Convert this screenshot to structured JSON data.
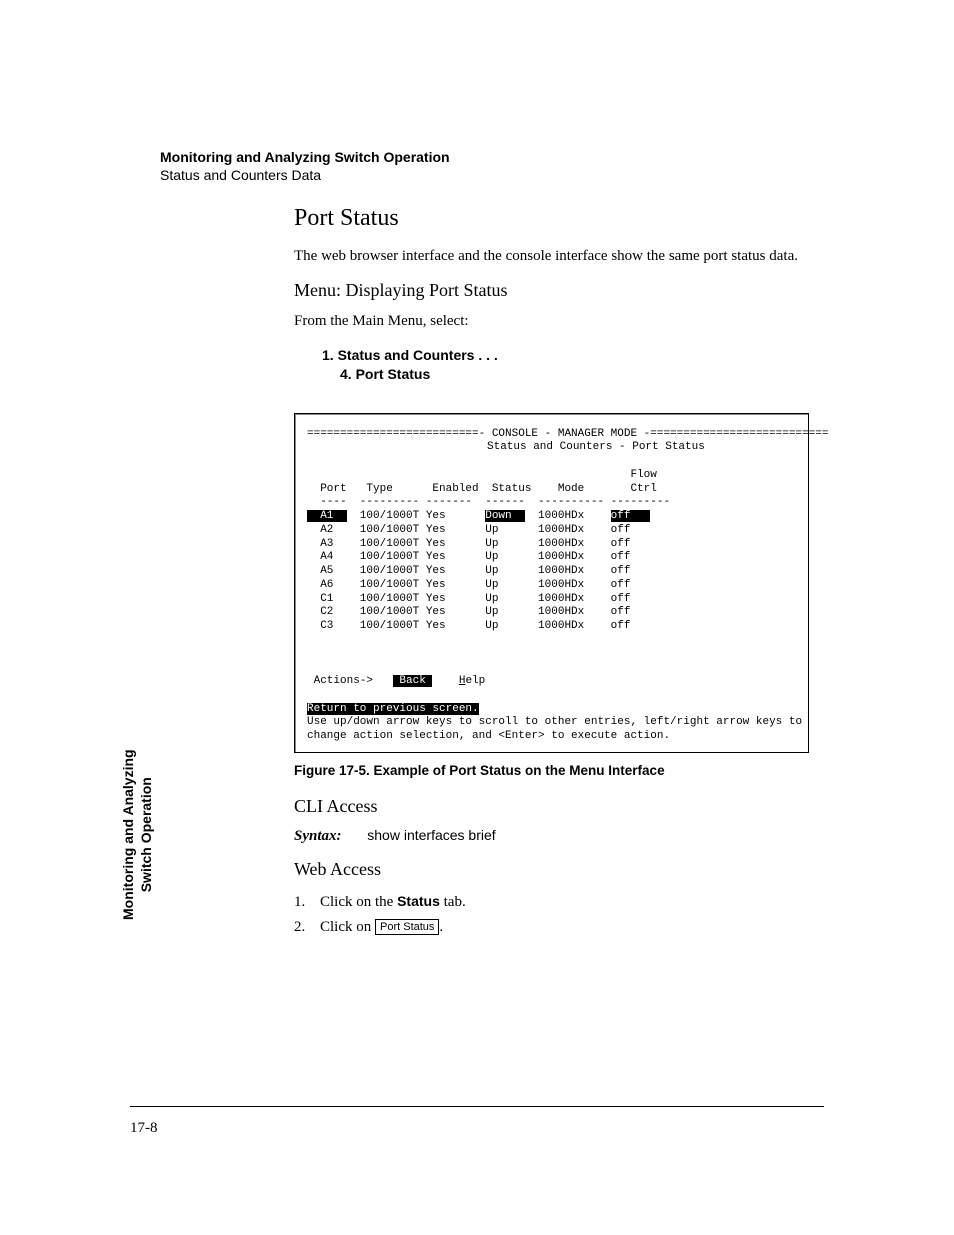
{
  "header": {
    "chapter": "Monitoring and Analyzing Switch Operation",
    "section": "Status and Counters Data"
  },
  "h2": "Port Status",
  "intro": "The web browser interface and the console interface show the same port status data.",
  "h3_menu": "Menu: Displaying Port Status",
  "menu_lead": "From the Main Menu, select:",
  "menu_path_1": "1. Status and Counters . . .",
  "menu_path_2": "4. Port Status",
  "terminal": {
    "title_line": "==========================- CONSOLE - MANAGER MODE -===========================",
    "subtitle": "Status and Counters - Port Status",
    "col_flow_top": "Flow",
    "cols": "  Port   Type      Enabled  Status    Mode       Ctrl",
    "col_line": "  ----  --------- -------  ------  ---------- ---------",
    "rows": [
      {
        "port": "A1",
        "type": "100/1000T",
        "enabled": "Yes",
        "status": "Down",
        "mode": "1000HDx",
        "flow": "off",
        "selected": true
      },
      {
        "port": "A2",
        "type": "100/1000T",
        "enabled": "Yes",
        "status": "Up",
        "mode": "1000HDx",
        "flow": "off",
        "selected": false
      },
      {
        "port": "A3",
        "type": "100/1000T",
        "enabled": "Yes",
        "status": "Up",
        "mode": "1000HDx",
        "flow": "off",
        "selected": false
      },
      {
        "port": "A4",
        "type": "100/1000T",
        "enabled": "Yes",
        "status": "Up",
        "mode": "1000HDx",
        "flow": "off",
        "selected": false
      },
      {
        "port": "A5",
        "type": "100/1000T",
        "enabled": "Yes",
        "status": "Up",
        "mode": "1000HDx",
        "flow": "off",
        "selected": false
      },
      {
        "port": "A6",
        "type": "100/1000T",
        "enabled": "Yes",
        "status": "Up",
        "mode": "1000HDx",
        "flow": "off",
        "selected": false
      },
      {
        "port": "C1",
        "type": "100/1000T",
        "enabled": "Yes",
        "status": "Up",
        "mode": "1000HDx",
        "flow": "off",
        "selected": false
      },
      {
        "port": "C2",
        "type": "100/1000T",
        "enabled": "Yes",
        "status": "Up",
        "mode": "1000HDx",
        "flow": "off",
        "selected": false
      },
      {
        "port": "C3",
        "type": "100/1000T",
        "enabled": "Yes",
        "status": "Up",
        "mode": "1000HDx",
        "flow": "off",
        "selected": false
      }
    ],
    "actions_label": " Actions->   ",
    "action_back": " Back ",
    "action_help_pre": "H",
    "action_help_rest": "elp",
    "return_line": "Return to previous screen.",
    "help1": "Use up/down arrow keys to scroll to other entries, left/right arrow keys to",
    "help2": "change action selection, and <Enter> to execute action."
  },
  "figure_caption": "Figure 17-5.  Example of Port Status on the Menu Interface",
  "h3_cli": "CLI Access",
  "syntax_label": "Syntax:",
  "syntax_cmd": "show interfaces brief",
  "h3_web": "Web Access",
  "web_steps": {
    "s1_pre": "Click on the ",
    "s1_bold": "Status",
    "s1_post": " tab.",
    "s2_pre": "Click on ",
    "s2_btn": "Port Status",
    "s2_post": "."
  },
  "side_tab_1": "Monitoring and Analyzing",
  "side_tab_2": "Switch Operation",
  "page_number": "17-8"
}
